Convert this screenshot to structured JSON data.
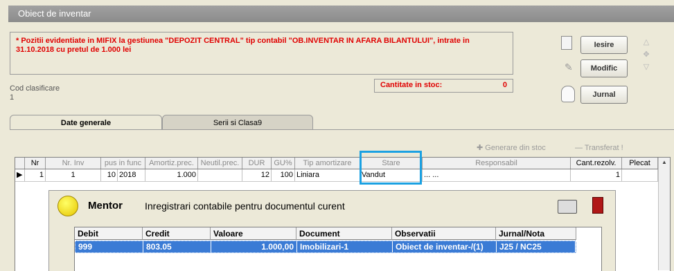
{
  "window": {
    "title": "Obiect de inventar"
  },
  "info": {
    "text": "* Pozitii evidentiate in MIFIX la gestiunea \"DEPOZIT CENTRAL\" tip contabil \"OB.INVENTAR IN AFARA BILANTULUI\", intrate in 31.10.2018 cu pretul de 1.000 lei"
  },
  "cod_clasificare": {
    "label": "Cod clasificare",
    "value": "1"
  },
  "stock": {
    "label": "Cantitate in stoc:",
    "value": "0"
  },
  "buttons": {
    "iesire": "Iesire",
    "modific": "Modific",
    "jurnal": "Jurnal"
  },
  "tabs": [
    {
      "label": "Date generale"
    },
    {
      "label": "Serii si Clasa9"
    }
  ],
  "toolbar": {
    "generare": "Generare din stoc",
    "transferat": "Transferat !"
  },
  "grid": {
    "headers": [
      "Nr",
      "Nr. Inv",
      "pus in func",
      "Amortiz.prec.",
      "Neutil.prec.",
      "DUR",
      "GU%",
      "Tip amortizare",
      "Stare",
      "Responsabil",
      "Cant.rezolv.",
      "Plecat"
    ],
    "row": {
      "nr": "1",
      "nr_inv": "1",
      "luna": "10",
      "an": "2018",
      "amortiz": "1.000",
      "neutil": "",
      "dur": "12",
      "gu": "100",
      "tip": "Liniara",
      "stare": "Vandut",
      "responsabil": "... ...",
      "cant": "1",
      "plecat": ""
    }
  },
  "mentor": {
    "title": "Mentor",
    "subtitle": "Inregistrari contabile pentru documentul curent",
    "headers": [
      "Debit",
      "Credit",
      "Valoare",
      "Document",
      "Observatii",
      "Jurnal/Nota"
    ],
    "row": {
      "debit": "999",
      "credit": "803.05",
      "valoare": "1.000,00",
      "document": "Imobilizari-1",
      "observatii": "Obiect de inventar-/(1)",
      "jurnal": "J25 / NC25"
    }
  },
  "colors": {
    "accent": "#1ba1e2",
    "alert": "#e00000",
    "selection": "#3a7bd5"
  }
}
